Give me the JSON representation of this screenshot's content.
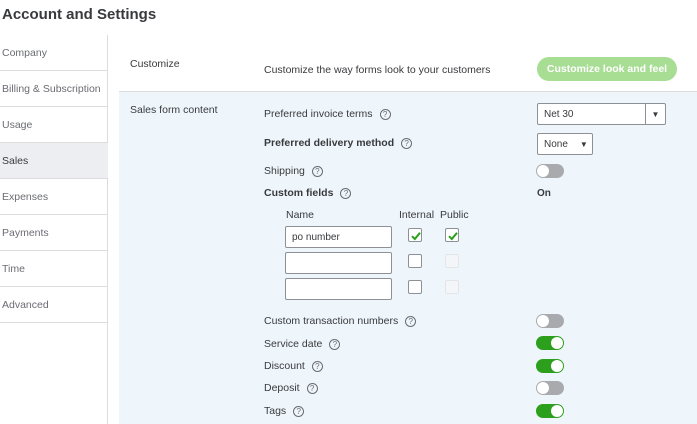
{
  "page": {
    "title": "Account and Settings"
  },
  "sidebar": {
    "items": [
      {
        "label": "Company",
        "active": false
      },
      {
        "label": "Billing & Subscription",
        "active": false
      },
      {
        "label": "Usage",
        "active": false
      },
      {
        "label": "Sales",
        "active": true
      },
      {
        "label": "Expenses",
        "active": false
      },
      {
        "label": "Payments",
        "active": false
      },
      {
        "label": "Time",
        "active": false
      },
      {
        "label": "Advanced",
        "active": false
      }
    ]
  },
  "customize": {
    "title": "Customize",
    "description": "Customize the way forms look to your customers",
    "button_label": "Customize look and feel"
  },
  "sales_form": {
    "title": "Sales form content",
    "invoice_terms": {
      "label": "Preferred invoice terms",
      "value": "Net 30"
    },
    "delivery_method": {
      "label": "Preferred delivery method",
      "value": "None"
    },
    "shipping": {
      "label": "Shipping",
      "on": false
    },
    "custom_fields": {
      "label": "Custom fields",
      "status": "On",
      "columns": {
        "name": "Name",
        "internal": "Internal",
        "public": "Public"
      },
      "rows": [
        {
          "name": "po number",
          "internal": true,
          "public": true
        },
        {
          "name": "",
          "internal": false,
          "public": false
        },
        {
          "name": "",
          "internal": false,
          "public": false
        }
      ]
    },
    "custom_transaction_numbers": {
      "label": "Custom transaction numbers",
      "on": false
    },
    "service_date": {
      "label": "Service date",
      "on": true
    },
    "discount": {
      "label": "Discount",
      "on": true
    },
    "deposit": {
      "label": "Deposit",
      "on": false
    },
    "tags": {
      "label": "Tags",
      "on": true
    }
  },
  "colors": {
    "accent_green": "#2ca01c",
    "button_green": "#a8dd94",
    "section_bg": "#eef6fb"
  }
}
